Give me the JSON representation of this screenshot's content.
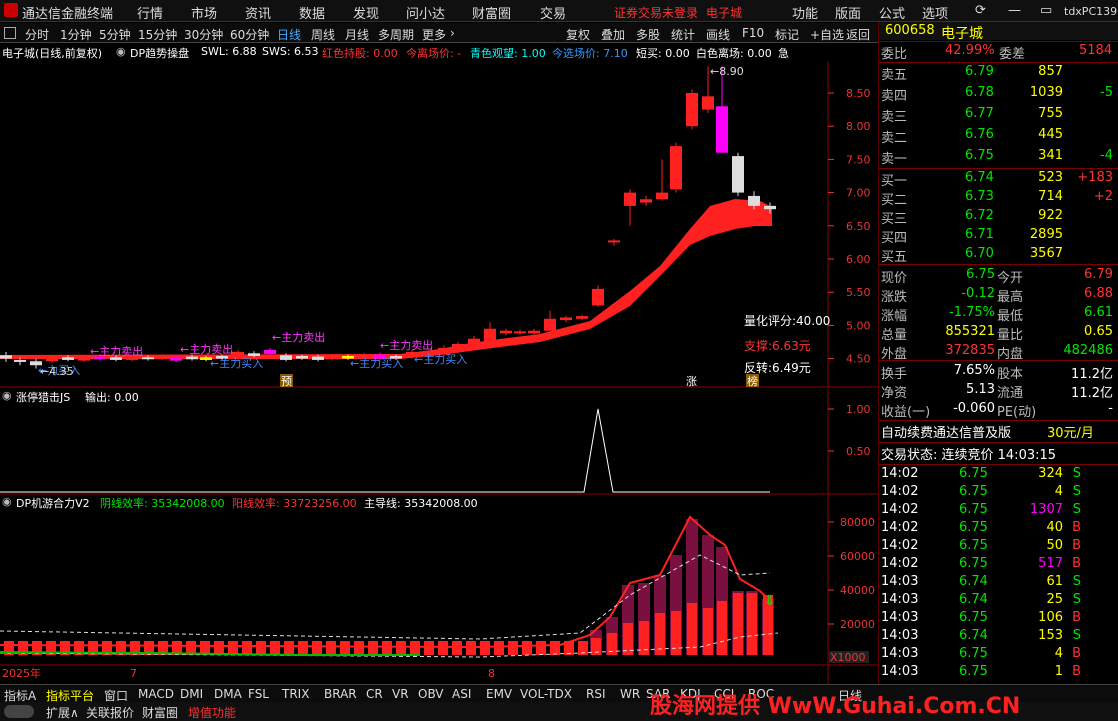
{
  "app": {
    "title": "通达信金融终端",
    "right_tag": "tdxPC139"
  },
  "menu": [
    "行情",
    "市场",
    "资讯",
    "数据",
    "发现",
    "问小达",
    "财富圈",
    "交易"
  ],
  "menu_right": [
    "功能",
    "版面",
    "公式",
    "选项"
  ],
  "login_notice": "证券交易未登录",
  "stock_name_top": "电子城",
  "periods": [
    "分时",
    "1分钟",
    "5分钟",
    "15分钟",
    "30分钟",
    "60分钟",
    "日线",
    "周线",
    "月线",
    "多周期",
    "更多"
  ],
  "active_period": "日线",
  "toolbar_right": [
    "复权",
    "叠加",
    "多股",
    "统计",
    "画线",
    "F10",
    "标记",
    "+自选",
    "返回"
  ],
  "main_panel": {
    "title": "电子城(日线,前复权)",
    "indicator": "DP趋势操盘",
    "swl": "SWL: 6.88",
    "sws": "SWS: 6.53",
    "red_hold": "红色持股: 0.00",
    "today_entry": "今离场价: -",
    "cyan_watch": "青色观望: 1.00",
    "today_select": "今选场价: 7.10",
    "short_buy": "短买: 0.00",
    "white_exit": "白色离场: 0.00",
    "urgent": "急",
    "y_labels": [
      "8.50",
      "8.00",
      "7.50",
      "7.00",
      "6.50",
      "6.00",
      "5.50",
      "5.00",
      "4.50"
    ],
    "high_mark": "8.90",
    "low_mark": "4.35",
    "score": "量化评分:40.00",
    "support": "支撑:6.63元",
    "reverse": "反转:6.49元",
    "annotations": [
      "主力卖出",
      "主力卖出",
      "主力买入",
      "主力卖出",
      "主力买入",
      "主力买入",
      "主力卖出",
      "主力买入"
    ],
    "markers": [
      "预",
      "涨",
      "榜"
    ]
  },
  "sub1": {
    "title": "涨停猎击JS",
    "output": "输出: 0.00",
    "y_labels": [
      "1.00",
      "0.50"
    ]
  },
  "sub2": {
    "title": "DP机游合力V2",
    "neg": "阴线效率: 35342008.00",
    "pos": "阳线效率: 33723256.00",
    "main": "主导线: 35342008.00",
    "y_labels": [
      "80000",
      "60000",
      "40000",
      "20000"
    ],
    "unit": "X1000",
    "dates": [
      "2025年",
      "7",
      "8"
    ]
  },
  "right": {
    "code": "600658",
    "name": "电子城",
    "weibi_label": "委比",
    "weibi": "42.99%",
    "weicha_label": "委差",
    "weicha": "5184",
    "asks": [
      {
        "label": "卖五",
        "price": "6.79",
        "vol": "857",
        "chg": ""
      },
      {
        "label": "卖四",
        "price": "6.78",
        "vol": "1039",
        "chg": "-5"
      },
      {
        "label": "卖三",
        "price": "6.77",
        "vol": "755",
        "chg": ""
      },
      {
        "label": "卖二",
        "price": "6.76",
        "vol": "445",
        "chg": ""
      },
      {
        "label": "卖一",
        "price": "6.75",
        "vol": "341",
        "chg": "-4"
      }
    ],
    "bids": [
      {
        "label": "买一",
        "price": "6.74",
        "vol": "523",
        "chg": "+183"
      },
      {
        "label": "买二",
        "price": "6.73",
        "vol": "714",
        "chg": "+2"
      },
      {
        "label": "买三",
        "price": "6.72",
        "vol": "922",
        "chg": ""
      },
      {
        "label": "买四",
        "price": "6.71",
        "vol": "2895",
        "chg": ""
      },
      {
        "label": "买五",
        "price": "6.70",
        "vol": "3567",
        "chg": ""
      }
    ],
    "stats": [
      [
        "现价",
        "6.75",
        "今开",
        "6.79"
      ],
      [
        "涨跌",
        "-0.12",
        "最高",
        "6.88"
      ],
      [
        "涨幅",
        "-1.75%",
        "最低",
        "6.61"
      ],
      [
        "总量",
        "855321",
        "量比",
        "0.65"
      ],
      [
        "外盘",
        "372835",
        "内盘",
        "482486"
      ]
    ],
    "stats2": [
      [
        "换手",
        "7.65%",
        "股本",
        "11.2亿"
      ],
      [
        "净资",
        "5.13",
        "流通",
        "11.2亿"
      ],
      [
        "收益(一)",
        "-0.060",
        "PE(动)",
        "-"
      ]
    ],
    "promo": "自动续费通达信普及版",
    "promo_price": "30元/月",
    "trade_status": "交易状态: 连续竞价 14:03:15",
    "ticks": [
      [
        "14:02",
        "6.75",
        "324",
        "S"
      ],
      [
        "14:02",
        "6.75",
        "4",
        "S"
      ],
      [
        "14:02",
        "6.75",
        "1307",
        "S"
      ],
      [
        "14:02",
        "6.75",
        "40",
        "B"
      ],
      [
        "14:02",
        "6.75",
        "50",
        "B"
      ],
      [
        "14:02",
        "6.75",
        "517",
        "B"
      ],
      [
        "14:03",
        "6.74",
        "61",
        "S"
      ],
      [
        "14:03",
        "6.74",
        "25",
        "S"
      ],
      [
        "14:03",
        "6.75",
        "106",
        "B"
      ],
      [
        "14:03",
        "6.74",
        "153",
        "S"
      ],
      [
        "14:03",
        "6.75",
        "4",
        "B"
      ],
      [
        "14:03",
        "6.75",
        "1",
        "B"
      ]
    ]
  },
  "bottom_tabs": [
    "指标A",
    "指标平台",
    "窗口",
    "MACD",
    "DMI",
    "DMA",
    "FSL",
    "TRIX",
    "BRAR",
    "CR",
    "VR",
    "OBV",
    "ASI",
    "EMV",
    "VOL-TDX",
    "RSI",
    "WR",
    "SAR",
    "KDJ",
    "CCI",
    "ROC"
  ],
  "bottom_right": "日线",
  "status_items": [
    "扩展∧",
    "关联报价",
    "财富圈",
    "增值功能"
  ],
  "watermark": "股海网提供 WwW.Guhai.Com.CN"
}
